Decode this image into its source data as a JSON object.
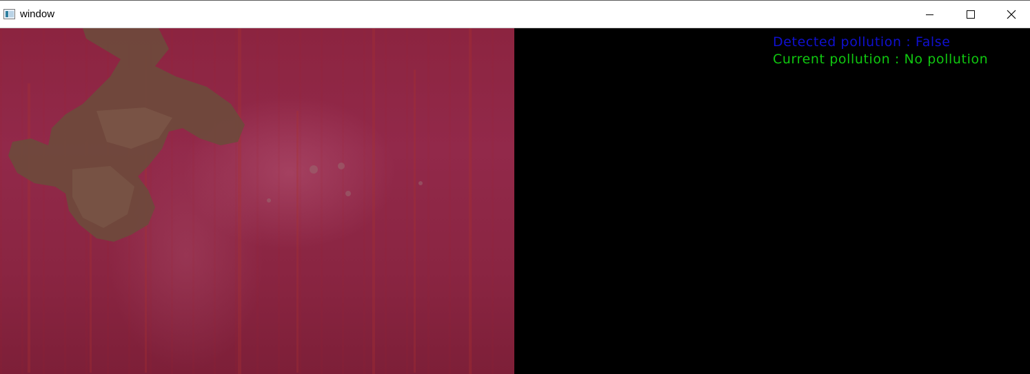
{
  "window": {
    "title": "window",
    "controls": [
      "minimize",
      "maximize",
      "close"
    ]
  },
  "overlay": {
    "detected_label": "Detected pollution : False",
    "current_label": "Current pollution : No pollution",
    "detected_color": "#1010d0",
    "current_color": "#10c810"
  },
  "icons": {
    "app": "window-app-icon",
    "minimize": "minimize-icon",
    "maximize": "maximize-icon",
    "close": "close-icon"
  }
}
